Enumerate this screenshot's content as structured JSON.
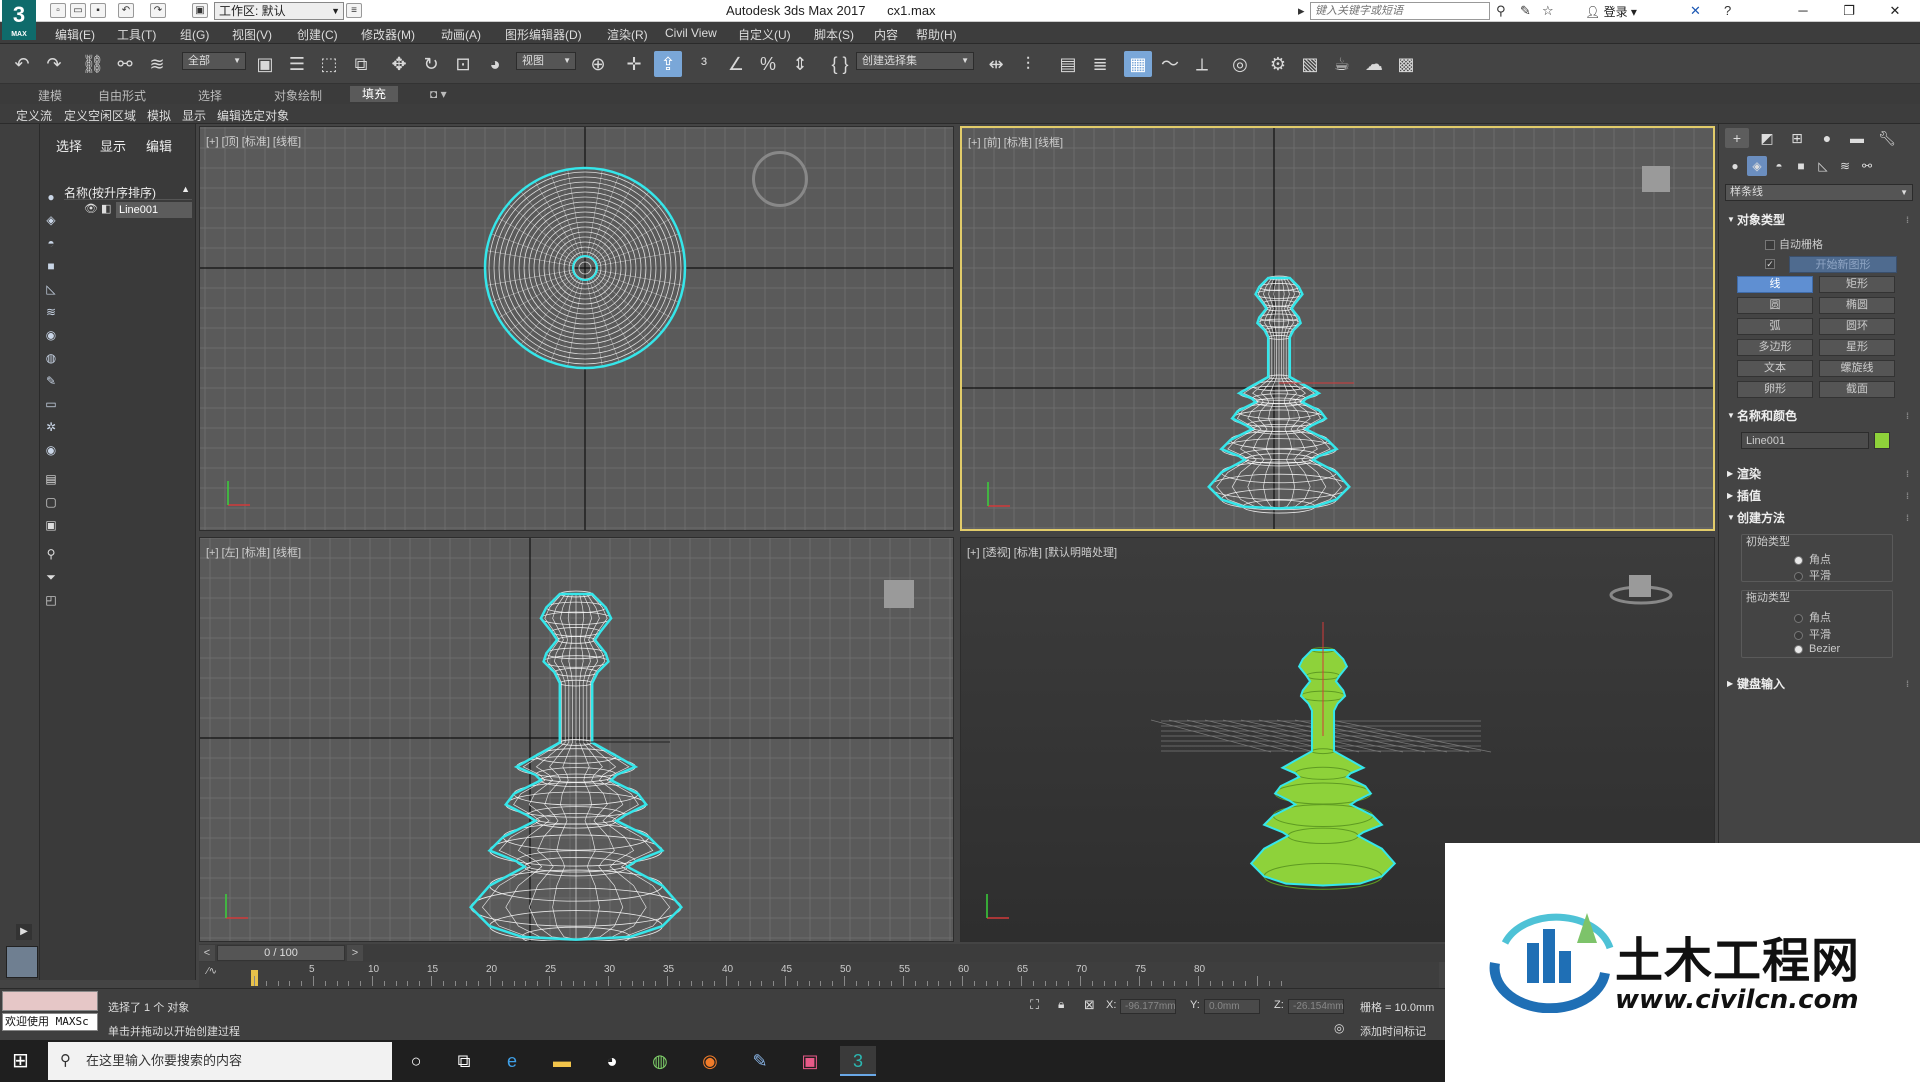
{
  "titlebar": {
    "logo_num": "3",
    "logo_sub": "MAX",
    "workspace": "工作区: 默认",
    "app_title": "Autodesk 3ds Max 2017",
    "file_name": "cx1.max",
    "search_placeholder": "键入关键字或短语",
    "login": "登录"
  },
  "menu": [
    "编辑(E)",
    "工具(T)",
    "组(G)",
    "视图(V)",
    "创建(C)",
    "修改器(M)",
    "动画(A)",
    "图形编辑器(D)",
    "渲染(R)",
    "Civil View",
    "自定义(U)",
    "脚本(S)",
    "内容",
    "帮助(H)"
  ],
  "toolbar": {
    "selection_filter": "全部",
    "ref_coord": "视图",
    "named_selection": "创建选择集"
  },
  "ribbon": {
    "tabs": [
      "建模",
      "自由形式",
      "选择",
      "对象绘制",
      "填充"
    ],
    "active_tab": "填充",
    "subtabs": [
      "定义流",
      "定义空闲区域",
      "模拟",
      "显示",
      "编辑选定对象"
    ]
  },
  "explorer": {
    "tabs": [
      "选择",
      "显示",
      "编辑"
    ],
    "column_header": "名称(按升序排序)",
    "items": [
      "Line001"
    ]
  },
  "viewports": {
    "top_label": "[+] [顶] [标准] [线框]",
    "front_label": "[+] [前] [标准] [线框]",
    "left_label": "[+] [左] [标准] [线框]",
    "persp_label": "[+] [透视] [标准] [默认明暗处理]"
  },
  "command_panel": {
    "category": "样条线",
    "object_type_title": "对象类型",
    "autogrid": "自动栅格",
    "start_new_shape": "开始新图形",
    "start_new_checked": "✓",
    "buttons": [
      [
        "线",
        "矩形"
      ],
      [
        "圆",
        "椭圆"
      ],
      [
        "弧",
        "圆环"
      ],
      [
        "多边形",
        "星形"
      ],
      [
        "文本",
        "螺旋线"
      ],
      [
        "卵形",
        "截面"
      ]
    ],
    "active_button": "线",
    "name_color_title": "名称和颜色",
    "object_name": "Line001",
    "object_color": "#8ed23a",
    "rendering_title": "渲染",
    "interpolation_title": "插值",
    "creation_method_title": "创建方法",
    "initial_type_label": "初始类型",
    "initial_options": [
      "角点",
      "平滑"
    ],
    "initial_selected": 0,
    "drag_type_label": "拖动类型",
    "drag_options": [
      "角点",
      "平滑",
      "Bezier"
    ],
    "drag_selected": 2,
    "keyboard_entry_title": "键盘输入"
  },
  "timeline": {
    "frame_display": "0 / 100",
    "current_frame": 0,
    "total_frames": 100,
    "ruler_labels": [
      "5",
      "10",
      "15",
      "20",
      "25",
      "30",
      "35",
      "40",
      "45",
      "50",
      "55",
      "60",
      "65",
      "70",
      "75",
      "80"
    ]
  },
  "status": {
    "maxscript_text": "欢迎使用 MAXSc",
    "selected_text": "选择了 1 个 对象",
    "prompt_text": "单击并拖动以开始创建过程",
    "x_label": "X:",
    "x_value": "-96.177mm",
    "y_label": "Y:",
    "y_value": "0.0mm",
    "z_label": "Z:",
    "z_value": "-26.154mm",
    "grid": "栅格 = 10.0mm",
    "add_time_tag": "添加时间标记"
  },
  "taskbar": {
    "search_placeholder": "在这里输入你要搜索的内容"
  },
  "watermark": {
    "title": "土木工程网",
    "url": "www.civilcn.com"
  },
  "colors": {
    "selection_cyan": "#35e6ea",
    "wire_white": "#ffffff",
    "object_green": "#8ed23a",
    "active_viewport": "#e2cc6a",
    "active_button": "#5f8fd2"
  }
}
